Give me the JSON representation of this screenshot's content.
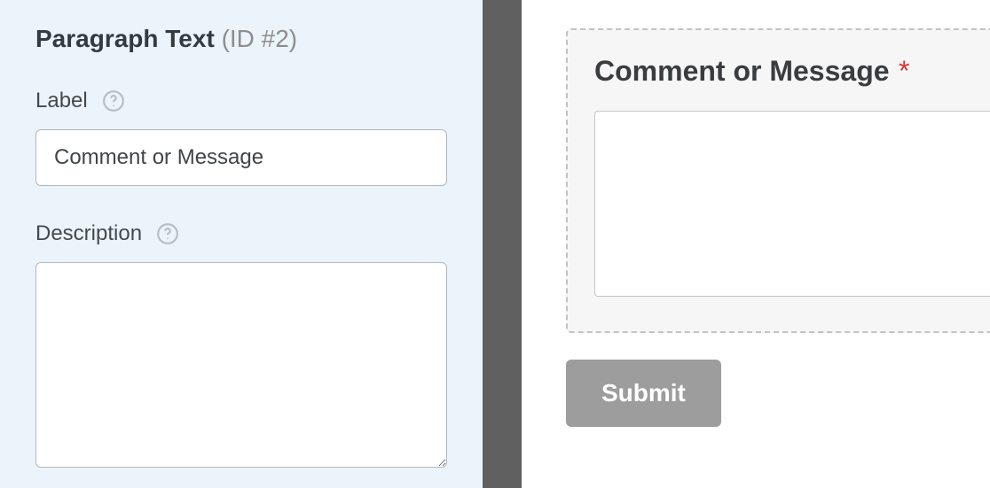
{
  "sidebar": {
    "title": "Paragraph Text",
    "id_tag": "(ID #2)",
    "label_field": {
      "label": "Label",
      "value": "Comment or Message"
    },
    "description_field": {
      "label": "Description",
      "value": ""
    }
  },
  "preview": {
    "field_label": "Comment or Message",
    "required_marker": "*",
    "submit_label": "Submit"
  }
}
